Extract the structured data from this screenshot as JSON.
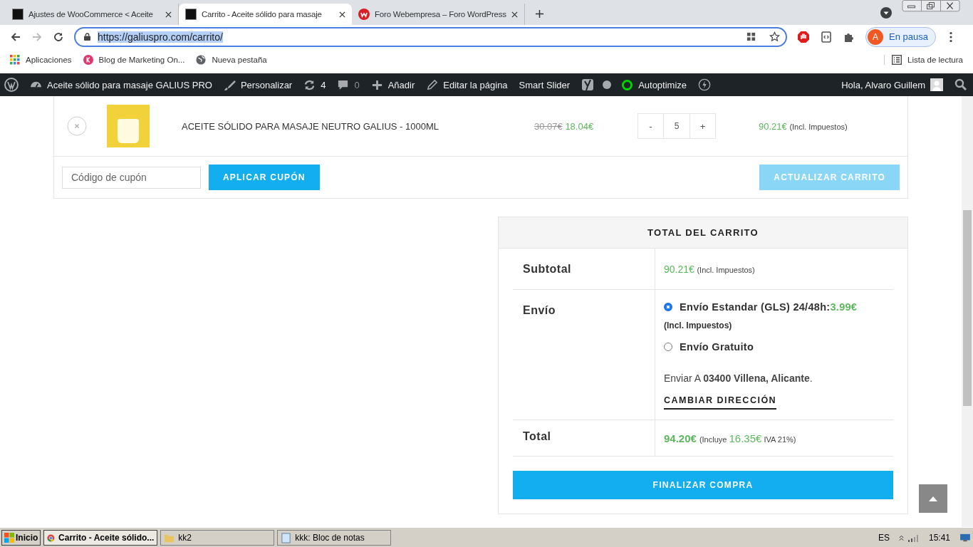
{
  "browser": {
    "tabs": [
      {
        "title": "Ajustes de WooCommerce < Aceite",
        "selected": false
      },
      {
        "title": "Carrito - Aceite sólido para masaje",
        "selected": true
      },
      {
        "title": "Foro Webempresa – Foro WordPress",
        "selected": false
      }
    ],
    "url": "https://galiuspro.com/carrito/",
    "profile": {
      "initial": "A",
      "label": "En pausa"
    },
    "bookmarks": [
      {
        "label": "Aplicaciones"
      },
      {
        "label": "Blog de Marketing On..."
      },
      {
        "label": "Nueva pestaña"
      }
    ],
    "reading_list": "Lista de lectura"
  },
  "admin_bar": {
    "site": "Aceite sólido para masaje GALIUS PRO",
    "customize": "Personalizar",
    "updates": "4",
    "comments": "0",
    "add": "Añadir",
    "edit": "Editar la página",
    "slider": "Smart Slider",
    "autoptimize": "Autoptimize",
    "greeting": "Hola, Alvaro Guillem"
  },
  "cart": {
    "item": {
      "name": "ACEITE SÓLIDO PARA MASAJE NEUTRO GALIUS - 1000ML",
      "old_price": "30.07€",
      "price": "18.04€",
      "minus": "-",
      "quantity": "5",
      "plus": "+",
      "subtotal": "90.21€",
      "subtotal_note": "(Incl. Impuestos)"
    },
    "coupon": {
      "placeholder": "Código de cupón"
    },
    "apply": "APLICAR CUPÓN",
    "update": {
      "label": "ACTUALIZAR CARRITO",
      "disabled": true
    }
  },
  "totals": {
    "title": "TOTAL DEL CARRITO",
    "subtotal": {
      "label": "Subtotal",
      "amount": "90.21€",
      "note": "(Incl. Impuestos)"
    },
    "shipping": {
      "label": "Envío",
      "options": [
        {
          "label": "Envío Estandar (GLS) 24/48h:",
          "price": "3.99€",
          "note": "(Incl. Impuestos)",
          "selected": true
        },
        {
          "label": "Envío Gratuito",
          "selected": false
        }
      ],
      "ship_to": "Enviar A **03400 Villena, Alicante**.",
      "change": "CAMBIAR DIRECCIÓN"
    },
    "total": {
      "label": "Total",
      "amount": "94.20€",
      "note_start": "(Incluye",
      "tax": "16.35€",
      "note_end": "IVA 21%)"
    },
    "checkout": "FINALIZAR COMPRA"
  },
  "taskbar": {
    "start": "Inicio",
    "windows": [
      {
        "title": "Carrito - Aceite sólido...",
        "selected": true
      },
      {
        "title": "kk2",
        "selected": false
      },
      {
        "title": "kkk: Bloc de notas",
        "selected": false
      }
    ],
    "lang": "ES",
    "clock": "15:41"
  }
}
